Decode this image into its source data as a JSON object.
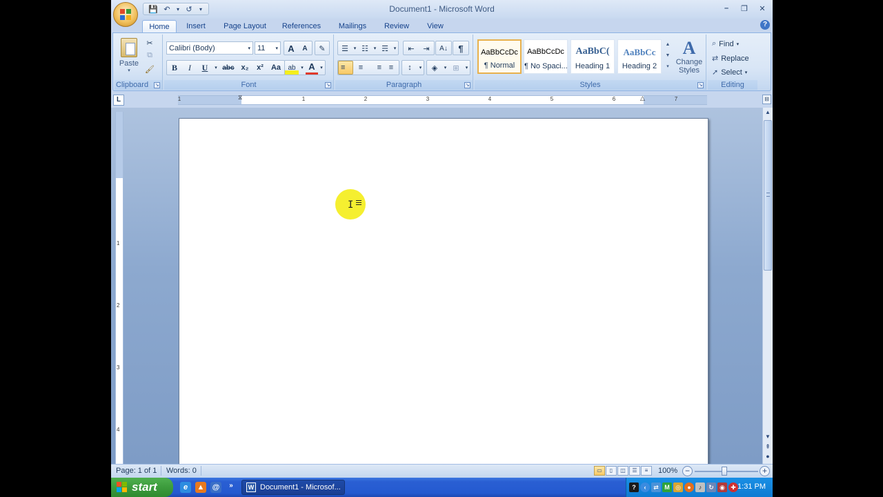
{
  "window": {
    "title": "Document1 - Microsoft Word",
    "minimize": "–",
    "restore": "❐",
    "close": "✕"
  },
  "qat": {
    "save": "💾",
    "undo": "↶",
    "undo_more": "▾",
    "redo": "↺",
    "customize": "▾"
  },
  "tabs": [
    {
      "label": "Home",
      "active": true
    },
    {
      "label": "Insert"
    },
    {
      "label": "Page Layout"
    },
    {
      "label": "References"
    },
    {
      "label": "Mailings"
    },
    {
      "label": "Review"
    },
    {
      "label": "View"
    }
  ],
  "help": "?",
  "ribbon": {
    "clipboard": {
      "paste_label": "Paste",
      "group_label": "Clipboard"
    },
    "font": {
      "font_name": "Calibri (Body)",
      "font_size": "11",
      "grow": "A",
      "shrink": "A",
      "clear": "✎",
      "bold": "B",
      "italic": "I",
      "underline": "U",
      "strike": "abc",
      "subscript": "x₂",
      "superscript": "x²",
      "case": "Aa",
      "highlight": "ab",
      "font_color": "A",
      "group_label": "Font"
    },
    "paragraph": {
      "bullets": "☰",
      "numbering": "☷",
      "multilevel": "☴",
      "decrease_indent": "⇤",
      "increase_indent": "⇥",
      "sort": "A↓",
      "pilcrow": "¶",
      "align_left": "≡",
      "center": "≡",
      "align_right": "≡",
      "justify": "≡",
      "line_spacing": "↕",
      "shading": "◈",
      "borders": "⊞",
      "group_label": "Paragraph"
    },
    "styles": {
      "items": [
        {
          "sample": "AaBbCcDc",
          "name": "¶ Normal",
          "selected": true
        },
        {
          "sample": "AaBbCcDc",
          "name": "¶ No Spaci..."
        },
        {
          "sample": "AaBbC(",
          "name": "Heading 1"
        },
        {
          "sample": "AaBbCc",
          "name": "Heading 2"
        }
      ],
      "change_styles": "Change Styles",
      "group_label": "Styles"
    },
    "editing": {
      "find": "Find",
      "replace": "Replace",
      "select": "Select",
      "group_label": "Editing"
    }
  },
  "ruler": {
    "tab_selector": "L",
    "numbers": [
      "1",
      "1",
      "2",
      "3",
      "4",
      "5",
      "6",
      "7"
    ],
    "view_ruler": "⊟"
  },
  "vruler": {
    "numbers": [
      "1",
      "2",
      "3",
      "4"
    ]
  },
  "status": {
    "page": "Page: 1 of 1",
    "words": "Words: 0",
    "zoom": "100%",
    "zoom_out": "−",
    "zoom_in": "+"
  },
  "taskbar": {
    "start": "start",
    "more": "»",
    "word_task": "Document1 - Microsof...",
    "clock": "1:31 PM"
  },
  "colors": {
    "accent": "#15428b",
    "highlight": "#f4ee1e",
    "taskbar": "#245ad0",
    "start": "#3c9b3c"
  }
}
